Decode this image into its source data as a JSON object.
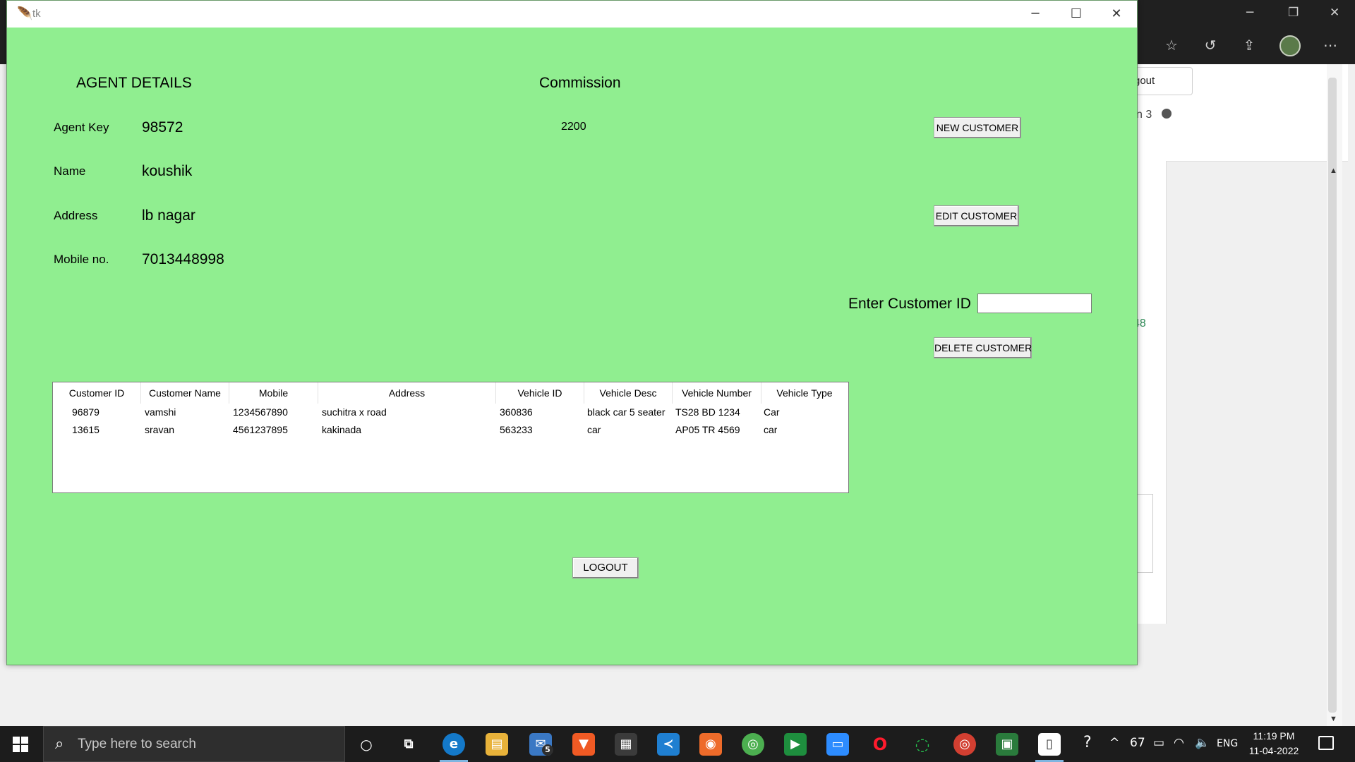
{
  "background_window": {
    "logout_partial": "gout",
    "row_partial": "n 3",
    "green_partial": "48"
  },
  "tk_window": {
    "title": "tk",
    "agent_details_heading": "AGENT DETAILS",
    "commission_heading": "Commission",
    "commission_value": "2200",
    "fields": {
      "agent_key_label": "Agent Key",
      "agent_key_value": "98572",
      "name_label": "Name",
      "name_value": "koushik",
      "address_label": "Address",
      "address_value": "lb nagar",
      "mobile_label": "Mobile no.",
      "mobile_value": "7013448998"
    },
    "buttons": {
      "new_customer": "NEW CUSTOMER",
      "edit_customer": "EDIT CUSTOMER",
      "delete_customer": "DELETE CUSTOMER",
      "logout": "LOGOUT"
    },
    "customer_id_label": "Enter Customer ID",
    "customer_id_value": "",
    "table": {
      "headers": [
        "Customer ID",
        "Customer Name",
        "Mobile",
        "Address",
        "Vehicle ID",
        "Vehicle Desc",
        "Vehicle Number",
        "Vehicle Type"
      ],
      "rows": [
        [
          "96879",
          "vamshi",
          "1234567890",
          "suchitra x road",
          "360836",
          "black car 5 seater",
          "TS28 BD 1234",
          "Car"
        ],
        [
          "13615",
          "sravan",
          "4561237895",
          "kakinada",
          "563233",
          "car",
          "AP05 TR 4569",
          "car"
        ]
      ]
    }
  },
  "taskbar": {
    "search_placeholder": "Type here to search",
    "mail_badge": "5",
    "battery_percent": "67",
    "language": "ENG",
    "time": "11:19 PM",
    "date": "11-04-2022"
  },
  "colors": {
    "app_background": "#90ee90",
    "taskbar": "#1c1c1c",
    "browser_frame": "#202020"
  }
}
